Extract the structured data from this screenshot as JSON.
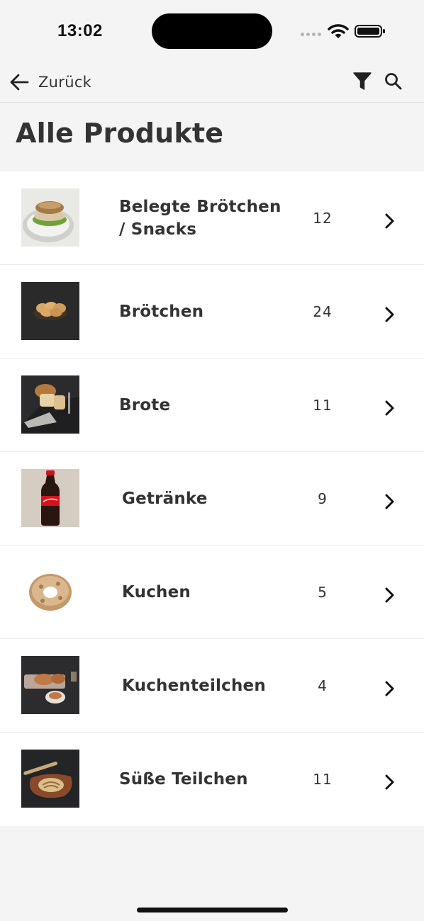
{
  "status_bar": {
    "time": "13:02"
  },
  "nav": {
    "back_label": "Zurück",
    "back_icon": "arrow-left-icon",
    "filter_icon": "filter-icon",
    "search_icon": "search-icon"
  },
  "page": {
    "title": "Alle Produkte"
  },
  "categories": [
    {
      "name": "Belegte Brötchen / Snacks",
      "count": "12",
      "image": "sandwich-photo"
    },
    {
      "name": "Brötchen",
      "count": "24",
      "image": "bread-rolls-photo"
    },
    {
      "name": "Brote",
      "count": "11",
      "image": "sliced-bread-photo"
    },
    {
      "name": "Getränke",
      "count": "9",
      "image": "cola-bottle-photo"
    },
    {
      "name": "Kuchen",
      "count": "5",
      "image": "cake-ring-photo"
    },
    {
      "name": "Kuchenteilchen",
      "count": "4",
      "image": "pastry-plate-photo"
    },
    {
      "name": "Süße Teilchen",
      "count": "11",
      "image": "sweet-pastry-photo"
    }
  ],
  "colors": {
    "background": "#f4f4f4",
    "list_background": "#ffffff",
    "text": "#333333",
    "divider": "#ececec"
  }
}
